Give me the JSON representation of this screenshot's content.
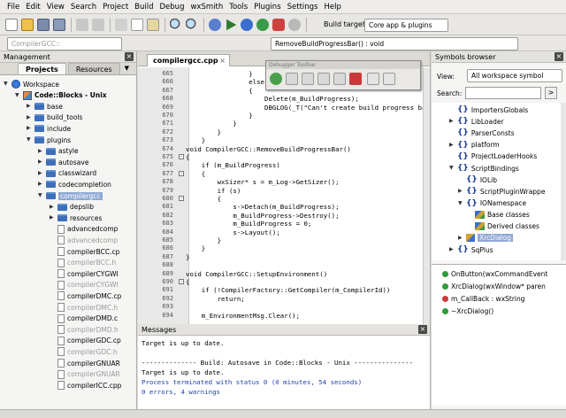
{
  "menu": [
    "File",
    "Edit",
    "View",
    "Search",
    "Project",
    "Build",
    "Debug",
    "wxSmith",
    "Tools",
    "Plugins",
    "Settings",
    "Help"
  ],
  "toolbar": {
    "build_target_label": "Build target:",
    "build_target_value": "Core app & plugins"
  },
  "toolbar2": {
    "scope_value": "CompilerGCC::",
    "function_value": "RemoveBuildProgressBar() : void"
  },
  "management": {
    "title": "Management",
    "tabs": [
      "Projects",
      "Resources"
    ],
    "tree": [
      {
        "label": "Workspace",
        "depth": 0,
        "kind": "workspace",
        "open": true
      },
      {
        "label": "Code::Blocks - Unix",
        "depth": 1,
        "kind": "project",
        "open": true,
        "bold": true
      },
      {
        "label": "base",
        "depth": 2,
        "kind": "folder",
        "open": false
      },
      {
        "label": "build_tools",
        "depth": 2,
        "kind": "folder",
        "open": false
      },
      {
        "label": "include",
        "depth": 2,
        "kind": "folder",
        "open": false
      },
      {
        "label": "plugins",
        "depth": 2,
        "kind": "folder",
        "open": true
      },
      {
        "label": "astyle",
        "depth": 3,
        "kind": "folder",
        "open": false
      },
      {
        "label": "autosave",
        "depth": 3,
        "kind": "folder",
        "open": false
      },
      {
        "label": "classwizard",
        "depth": 3,
        "kind": "folder",
        "open": false
      },
      {
        "label": "codecompletion",
        "depth": 3,
        "kind": "folder",
        "open": false
      },
      {
        "label": "compilergcc",
        "depth": 3,
        "kind": "folder",
        "open": true,
        "selected": true
      },
      {
        "label": "depslib",
        "depth": 4,
        "kind": "folder",
        "open": false
      },
      {
        "label": "resources",
        "depth": 4,
        "kind": "folder",
        "open": false
      },
      {
        "label": "advancedcomp",
        "depth": 4,
        "kind": "file"
      },
      {
        "label": "advancedcomp",
        "depth": 4,
        "kind": "file",
        "gray": true
      },
      {
        "label": "compilerBCC.cp",
        "depth": 4,
        "kind": "file"
      },
      {
        "label": "compilerBCC.h",
        "depth": 4,
        "kind": "file",
        "gray": true
      },
      {
        "label": "compilerCYGWI",
        "depth": 4,
        "kind": "file"
      },
      {
        "label": "compilerCYGWI",
        "depth": 4,
        "kind": "file",
        "gray": true
      },
      {
        "label": "compilerDMC.cp",
        "depth": 4,
        "kind": "file"
      },
      {
        "label": "compilerDMC.h",
        "depth": 4,
        "kind": "file",
        "gray": true
      },
      {
        "label": "compilerDMD.c",
        "depth": 4,
        "kind": "file"
      },
      {
        "label": "compilerDMD.h",
        "depth": 4,
        "kind": "file",
        "gray": true
      },
      {
        "label": "compilerGDC.cp",
        "depth": 4,
        "kind": "file"
      },
      {
        "label": "compilerGDC.h",
        "depth": 4,
        "kind": "file",
        "gray": true
      },
      {
        "label": "compilerGNUAR",
        "depth": 4,
        "kind": "file"
      },
      {
        "label": "compilerGNUAR",
        "depth": 4,
        "kind": "file",
        "gray": true
      },
      {
        "label": "compilerICC.cpp",
        "depth": 4,
        "kind": "file"
      }
    ]
  },
  "editor": {
    "tab_label": "compilergcc.cpp",
    "debugger_title": "Debugger Toolbar",
    "lines": [
      {
        "n": "665",
        "t": "                }",
        "f": ""
      },
      {
        "n": "666",
        "t": "                else",
        "kw": true,
        "f": ""
      },
      {
        "n": "667",
        "t": "                {",
        "f": ""
      },
      {
        "n": "668",
        "t": "                    Delete(m_BuildProgress);",
        "f": ""
      },
      {
        "n": "669",
        "t": "                    DBGLOG(_T(\"Can't create build progress bar: no sizer",
        "str": true,
        "f": ""
      },
      {
        "n": "670",
        "t": "                }",
        "f": ""
      },
      {
        "n": "671",
        "t": "            }",
        "f": ""
      },
      {
        "n": "672",
        "t": "        }",
        "f": ""
      },
      {
        "n": "673",
        "t": "    }",
        "f": ""
      },
      {
        "n": "674",
        "t": "void CompilerGCC::RemoveBuildProgressBar()",
        "kw": true,
        "f": ""
      },
      {
        "n": "675",
        "t": "{",
        "f": "-"
      },
      {
        "n": "676",
        "t": "    if (m_BuildProgress)",
        "kw": true,
        "f": ""
      },
      {
        "n": "677",
        "t": "    {",
        "f": "-"
      },
      {
        "n": "678",
        "t": "        wxSizer* s = m_Log->GetSizer();",
        "f": ""
      },
      {
        "n": "679",
        "t": "        if (s)",
        "kw": true,
        "f": ""
      },
      {
        "n": "680",
        "t": "        {",
        "f": "-"
      },
      {
        "n": "681",
        "t": "            s->Detach(m_BuildProgress);",
        "f": ""
      },
      {
        "n": "682",
        "t": "            m_BuildProgress->Destroy();",
        "f": ""
      },
      {
        "n": "683",
        "t": "            m_BuildProgress = 0;",
        "f": ""
      },
      {
        "n": "684",
        "t": "            s->Layout();",
        "f": ""
      },
      {
        "n": "685",
        "t": "        }",
        "f": ""
      },
      {
        "n": "686",
        "t": "    }",
        "f": ""
      },
      {
        "n": "687",
        "t": "}",
        "f": ""
      },
      {
        "n": "688",
        "t": "",
        "f": ""
      },
      {
        "n": "689",
        "t": "void CompilerGCC::SetupEnvironment()",
        "kw": true,
        "f": ""
      },
      {
        "n": "690",
        "t": "{",
        "f": "-"
      },
      {
        "n": "691",
        "t": "    if (!CompilerFactory::GetCompiler(m_CompilerId))",
        "kw": true,
        "f": ""
      },
      {
        "n": "692",
        "t": "        return;",
        "kw": true,
        "f": ""
      },
      {
        "n": "693",
        "t": "",
        "f": ""
      },
      {
        "n": "694",
        "t": "    m_EnvironmentMsg.Clear();",
        "f": ""
      }
    ]
  },
  "messages": {
    "title": "Messages",
    "lines": [
      {
        "t": "Target is up to date.",
        "c": "#000000"
      },
      {
        "t": "",
        "c": "#000000"
      },
      {
        "t": "-------------- Build: Autosave in Code::Blocks - Unix ---------------",
        "c": "#000000"
      },
      {
        "t": "Target is up to date.",
        "c": "#000000"
      },
      {
        "t": "Process terminated with status 0 (0 minutes, 54 seconds)",
        "c": "#1f3fae"
      },
      {
        "t": "0 errors, 4 warnings",
        "c": "#1f3fae"
      }
    ]
  },
  "symbols": {
    "title": "Symbols browser",
    "view_label": "View:",
    "view_value": "All workspace symbol",
    "search_label": "Search:",
    "search_value": "",
    "tree": [
      {
        "label": "ImportersGlobals",
        "depth": 0,
        "icon": "brace",
        "arrow": ""
      },
      {
        "label": "LibLoader",
        "depth": 0,
        "icon": "brace",
        "arrow": "▶"
      },
      {
        "label": "ParserConsts",
        "depth": 0,
        "icon": "brace",
        "arrow": ""
      },
      {
        "label": "platform",
        "depth": 0,
        "icon": "brace",
        "arrow": "▶"
      },
      {
        "label": "ProjectLoaderHooks",
        "depth": 0,
        "icon": "brace",
        "arrow": ""
      },
      {
        "label": "ScriptBindings",
        "depth": 0,
        "icon": "brace",
        "arrow": "▼"
      },
      {
        "label": "IOLib",
        "depth": 1,
        "icon": "brace",
        "arrow": ""
      },
      {
        "label": "ScriptPluginWrappe",
        "depth": 1,
        "icon": "brace",
        "arrow": "▶"
      },
      {
        "label": "IONamespace",
        "depth": 1,
        "icon": "brace",
        "arrow": "▼"
      },
      {
        "label": "Base classes",
        "depth": 2,
        "icon": "classes",
        "arrow": ""
      },
      {
        "label": "Derived classes",
        "depth": 2,
        "icon": "classes",
        "arrow": ""
      },
      {
        "label": "XrcDialog",
        "depth": 1,
        "icon": "class",
        "arrow": "▶",
        "selected": true
      },
      {
        "label": "SqPlus",
        "depth": 0,
        "icon": "brace",
        "arrow": "▶"
      }
    ],
    "members": [
      {
        "label": "OnButton(wxCommandEvent",
        "icon": "green"
      },
      {
        "label": "XrcDialog(wxWindow* paren",
        "icon": "green"
      },
      {
        "label": "m_CallBack : wxString",
        "icon": "red"
      },
      {
        "label": "~XrcDialog()",
        "icon": "green"
      }
    ]
  }
}
